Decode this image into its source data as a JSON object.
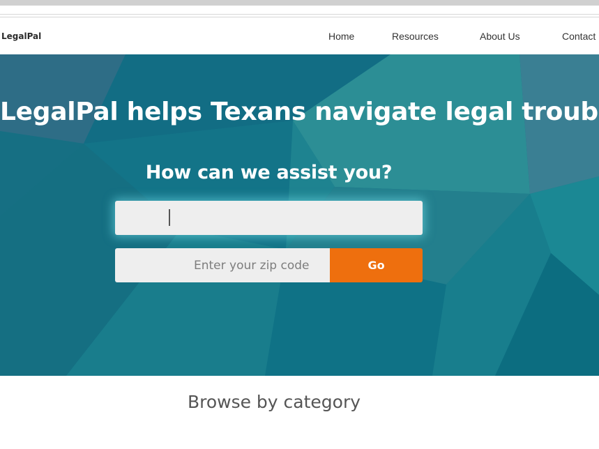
{
  "brand": {
    "logo": "LegalPal"
  },
  "nav": {
    "items": [
      {
        "label": "Home"
      },
      {
        "label": "Resources"
      },
      {
        "label": "About Us"
      },
      {
        "label": "Contact"
      }
    ]
  },
  "hero": {
    "title": "LegalPal helps Texans navigate legal troubles",
    "subtitle": "How can we assist you?",
    "query_value": "",
    "zip_placeholder": "Enter your zip code",
    "zip_value": "",
    "go_label": "Go"
  },
  "browse": {
    "heading": "Browse by category"
  },
  "colors": {
    "hero_base": "#17768a",
    "accent": "#ee6f0e",
    "input_bg": "#eeeeee"
  }
}
